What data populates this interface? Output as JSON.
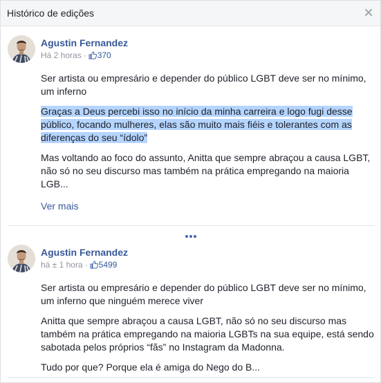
{
  "dialog": {
    "title": "Histórico de edições",
    "close_icon": "close-icon"
  },
  "colors": {
    "link": "#365899",
    "highlight": "#b5d5ff",
    "meta": "#90949c"
  },
  "edits": [
    {
      "author": "Agustin Fernandez",
      "time": "Há 2 horas",
      "separator": "·",
      "like_icon": "thumbs-up-icon",
      "like_count": "370",
      "paragraphs": [
        "Ser artista ou empresário e depender do público LGBT deve ser no mínimo, um inferno",
        "Graças a Deus percebi isso no início da minha carreira e logo fugi desse público, focando mulheres, elas são muito mais fiéis e tolerantes com as diferenças do seu “ídolo”",
        "Mas voltando ao foco do assunto, Anitta que sempre abraçou a causa LGBT, não só no seu discurso mas também na prática empregando na maioria LGB..."
      ],
      "see_more": "Ver mais"
    },
    {
      "author": "Agustin Fernandez",
      "time": "há ± 1 hora",
      "separator": "·",
      "like_icon": "thumbs-up-icon",
      "like_count": "5499",
      "paragraphs": [
        "Ser artista ou empresário e depender do público LGBT deve ser no mínimo, um inferno que ninguém merece viver",
        "Anitta que sempre abraçou a causa LGBT, não só no seu discurso mas também na prática empregando na maioria LGBTs na sua equipe, está sendo sabotada pelos próprios “fãs” no Instagram da Madonna.",
        "Tudo por que? Porque ela é amiga do Nego do B..."
      ]
    }
  ],
  "expand_icon": "more-dots-icon"
}
